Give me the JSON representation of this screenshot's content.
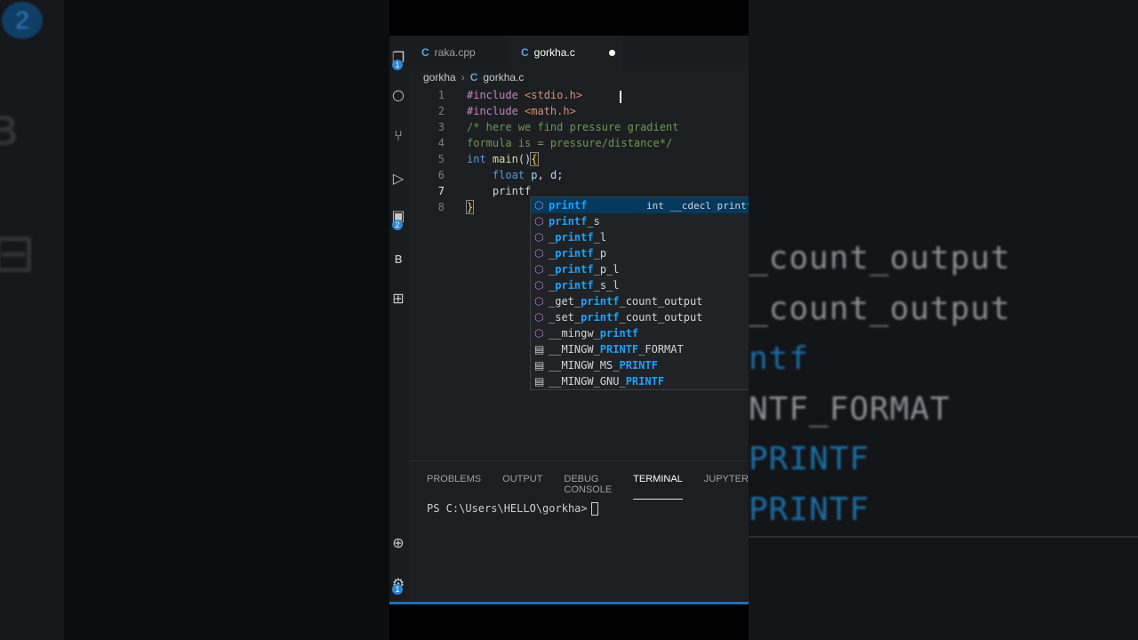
{
  "background": {
    "left_badge": "2",
    "right_lines": [
      {
        "text": "_count_output",
        "color": "#8a8f94"
      },
      {
        "text": "_count_output",
        "color": "#8a8f94"
      },
      {
        "text": "ntf",
        "color": "#1d6fa8"
      },
      {
        "text": "NTF_FORMAT",
        "color": "#8a8f94"
      },
      {
        "text": "PRINTF",
        "color": "#1d6fa8"
      },
      {
        "text": "PRINTF",
        "color": "#1d6fa8"
      }
    ]
  },
  "activity_bar": {
    "badges": [
      "1",
      "2",
      "1"
    ]
  },
  "tabs": [
    {
      "label": "raka.cpp",
      "icon": "C"
    },
    {
      "label": "gorkha.c",
      "icon": "C"
    }
  ],
  "breadcrumb": {
    "folder": "gorkha",
    "file": "gorkha.c",
    "file_icon": "C"
  },
  "code": {
    "line_numbers": [
      "1",
      "2",
      "3",
      "4",
      "5",
      "6",
      "7",
      "8"
    ],
    "current_line": "7"
  },
  "suggest": {
    "items": [
      {
        "pre": "",
        "match": "printf",
        "post": "",
        "kind": "function"
      },
      {
        "pre": "",
        "match": "printf",
        "post": "_s",
        "kind": "function"
      },
      {
        "pre": "_",
        "match": "printf",
        "post": "_l",
        "kind": "function"
      },
      {
        "pre": "_",
        "match": "printf",
        "post": "_p",
        "kind": "function"
      },
      {
        "pre": "_",
        "match": "printf",
        "post": "_p_l",
        "kind": "function"
      },
      {
        "pre": "_",
        "match": "printf",
        "post": "_s_l",
        "kind": "function"
      },
      {
        "pre": "_get_",
        "match": "printf",
        "post": "_count_output",
        "kind": "function"
      },
      {
        "pre": "_set_",
        "match": "printf",
        "post": "_count_output",
        "kind": "function"
      },
      {
        "pre": "__mingw_",
        "match": "printf",
        "post": "",
        "kind": "function"
      },
      {
        "pre": "__MINGW_",
        "match": "PRINTF",
        "post": "_FORMAT",
        "kind": "constant"
      },
      {
        "pre": "__MINGW_MS_",
        "match": "PRINTF",
        "post": "",
        "kind": "constant"
      },
      {
        "pre": "__MINGW_GNU_",
        "match": "PRINTF",
        "post": "",
        "kind": "constant"
      }
    ],
    "selected_detail": "int __cdecl printf"
  },
  "panel": {
    "tabs": [
      "PROBLEMS",
      "OUTPUT",
      "DEBUG CONSOLE",
      "TERMINAL",
      "JUPYTER"
    ],
    "active_tab": "TERMINAL",
    "prompt": "PS C:\\Users\\HELLO\\gorkha>"
  },
  "colors": {
    "accent": "#1d6fb8",
    "match": "#18a3ff",
    "selection": "#04395e"
  }
}
